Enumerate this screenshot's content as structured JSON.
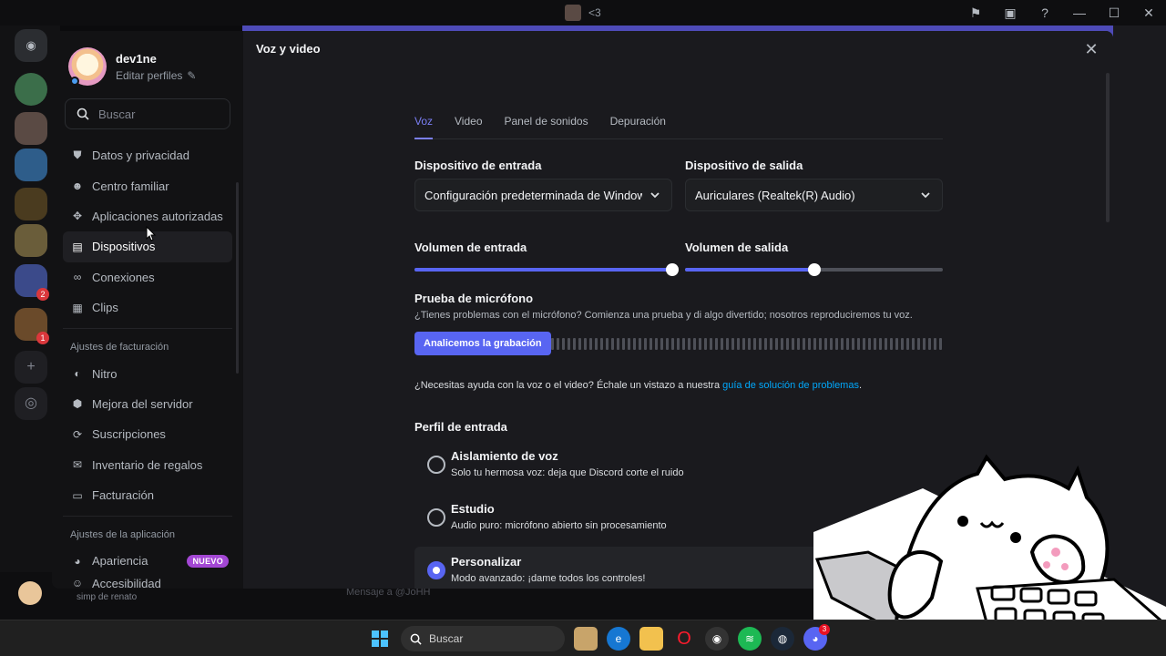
{
  "titlebar": {
    "title": "<3"
  },
  "rail": {
    "badges": [
      "2",
      "1"
    ]
  },
  "settings": {
    "user": {
      "name": "dev1ne",
      "edit_label": "Editar perfiles"
    },
    "search_placeholder": "Buscar",
    "nav_items_top": [
      {
        "label": "Datos y privacidad",
        "icon": "shield-icon",
        "active": false
      },
      {
        "label": "Centro familiar",
        "icon": "family-icon",
        "active": false
      },
      {
        "label": "Aplicaciones autorizadas",
        "icon": "apps-icon",
        "active": false
      },
      {
        "label": "Dispositivos",
        "icon": "devices-icon",
        "active": true
      },
      {
        "label": "Conexiones",
        "icon": "link-icon",
        "active": false
      },
      {
        "label": "Clips",
        "icon": "clips-icon",
        "active": false
      }
    ],
    "billing_heading": "Ajustes de facturación",
    "nav_items_billing": [
      {
        "label": "Nitro",
        "icon": "nitro-icon"
      },
      {
        "label": "Mejora del servidor",
        "icon": "boost-icon"
      },
      {
        "label": "Suscripciones",
        "icon": "subscriptions-icon"
      },
      {
        "label": "Inventario de regalos",
        "icon": "gift-icon"
      },
      {
        "label": "Facturación",
        "icon": "billing-icon"
      }
    ],
    "app_heading": "Ajustes de la aplicación",
    "nav_items_app": [
      {
        "label": "Apariencia",
        "icon": "palette-icon",
        "badge": "NUEVO"
      },
      {
        "label": "Accesibilidad",
        "icon": "accessibility-icon"
      }
    ]
  },
  "main": {
    "title": "Voz y video",
    "tabs": [
      {
        "label": "Voz",
        "active": true
      },
      {
        "label": "Video",
        "active": false
      },
      {
        "label": "Panel de sonidos",
        "active": false
      },
      {
        "label": "Depuración",
        "active": false
      }
    ],
    "input_device": {
      "label": "Dispositivo de entrada",
      "value": "Configuración predeterminada de Windows"
    },
    "output_device": {
      "label": "Dispositivo de salida",
      "value": "Auriculares (Realtek(R) Audio)"
    },
    "input_volume": {
      "label": "Volumen de entrada",
      "value": 1.0
    },
    "output_volume": {
      "label": "Volumen de salida",
      "value": 0.5
    },
    "mic_test": {
      "label": "Prueba de micrófono",
      "description": "¿Tienes problemas con el micrófono? Comienza una prueba y di algo divertido; nosotros reproduciremos tu voz.",
      "button": "Analicemos la grabación"
    },
    "help": {
      "text": "¿Necesitas ayuda con la voz o el video? Échale un vistazo a nuestra ",
      "link": "guía de solución de problemas",
      "suffix": "."
    },
    "input_profile": {
      "label": "Perfil de entrada",
      "options": [
        {
          "title": "Aislamiento de voz",
          "desc": "Solo tu hermosa voz: deja que Discord corte el ruido",
          "selected": false
        },
        {
          "title": "Estudio",
          "desc": "Audio puro: micrófono abierto sin procesamiento",
          "selected": false
        },
        {
          "title": "Personalizar",
          "desc": "Modo avanzado: ¡dame todos los controles!",
          "selected": true
        }
      ]
    }
  },
  "userbar": {
    "status": "simp de renato",
    "message_placeholder": "Mensaje a @JoHH"
  },
  "taskbar": {
    "search_label": "Buscar",
    "discord_badge": "3"
  },
  "colors": {
    "accent": "#5865f2",
    "link": "#00a8fc",
    "new_badge": "#a347d4"
  }
}
